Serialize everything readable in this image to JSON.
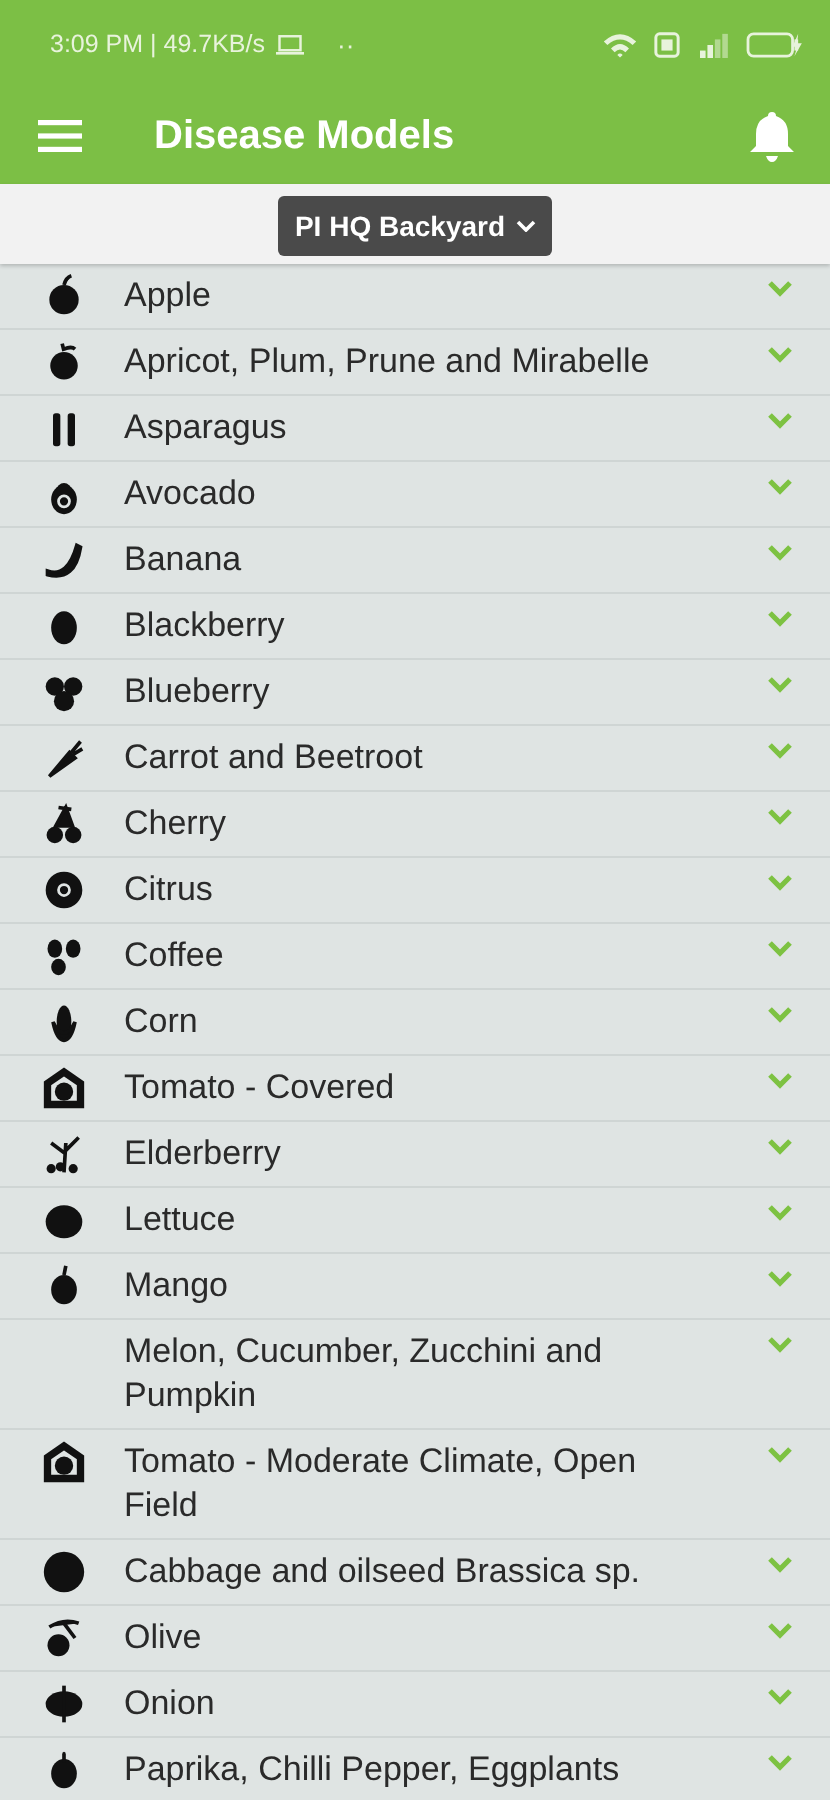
{
  "status_bar": {
    "time": "3:09 PM | 49.7KB/s",
    "dots": "··"
  },
  "app_bar": {
    "title": "Disease Models"
  },
  "location_picker": {
    "label": "PI HQ Backyard"
  },
  "models": [
    {
      "name": "Apple",
      "expanded": false
    },
    {
      "name": "Apricot, Plum, Prune and Mirabelle",
      "expanded": false
    },
    {
      "name": "Asparagus",
      "expanded": false
    },
    {
      "name": "Avocado",
      "expanded": false
    },
    {
      "name": "Banana",
      "expanded": false
    },
    {
      "name": "Blackberry",
      "expanded": false
    },
    {
      "name": "Blueberry",
      "expanded": false
    },
    {
      "name": "Carrot and Beetroot",
      "expanded": false
    },
    {
      "name": "Cherry",
      "expanded": false
    },
    {
      "name": "Citrus",
      "expanded": false
    },
    {
      "name": "Coffee",
      "expanded": false
    },
    {
      "name": "Corn",
      "expanded": false
    },
    {
      "name": "Tomato - Covered",
      "expanded": false
    },
    {
      "name": "Elderberry",
      "expanded": false
    },
    {
      "name": "Lettuce",
      "expanded": false
    },
    {
      "name": "Mango",
      "expanded": false
    },
    {
      "name": "Melon, Cucumber, Zucchini and Pumpkin",
      "expanded": false
    },
    {
      "name": "Tomato - Moderate Climate, Open Field",
      "expanded": false
    },
    {
      "name": "Cabbage and oilseed Brassica sp.",
      "expanded": false
    },
    {
      "name": "Olive",
      "expanded": false
    },
    {
      "name": "Onion",
      "expanded": false
    },
    {
      "name": "Paprika, Chilli Pepper, Eggplants",
      "expanded": false
    }
  ]
}
